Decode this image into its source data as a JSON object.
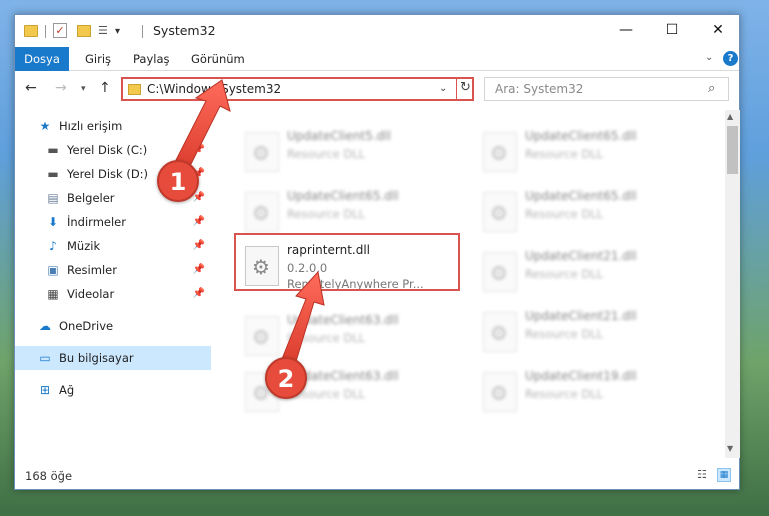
{
  "window": {
    "title": "System32",
    "min_glyph": "—",
    "max_glyph": "☐",
    "close_glyph": "✕"
  },
  "ribbon": {
    "file_tab": "Dosya",
    "tabs": [
      "Giriş",
      "Paylaş",
      "Görünüm"
    ],
    "help": "?"
  },
  "nav": {
    "back": "←",
    "forward": "→",
    "up": "↑",
    "address": "C:\\Windows\\System32",
    "refresh": "↻",
    "search_placeholder": "Ara: System32"
  },
  "sidebar": {
    "items": [
      {
        "label": "Hızlı erişim",
        "icon": "star-icon",
        "pinned": false
      },
      {
        "label": "Yerel Disk (C:)",
        "icon": "drive-icon",
        "pinned": true
      },
      {
        "label": "Yerel Disk (D:)",
        "icon": "drive-icon",
        "pinned": true
      },
      {
        "label": "Belgeler",
        "icon": "document-icon",
        "pinned": true
      },
      {
        "label": "İndirmeler",
        "icon": "download-icon",
        "pinned": true
      },
      {
        "label": "Müzik",
        "icon": "music-icon",
        "pinned": true
      },
      {
        "label": "Resimler",
        "icon": "picture-icon",
        "pinned": true
      },
      {
        "label": "Videolar",
        "icon": "video-icon",
        "pinned": true
      },
      {
        "label": "OneDrive",
        "icon": "cloud-icon",
        "pinned": false
      },
      {
        "label": "Bu bilgisayar",
        "icon": "computer-icon",
        "pinned": false,
        "selected": true
      },
      {
        "label": "Ağ",
        "icon": "network-icon",
        "pinned": false
      }
    ]
  },
  "files": {
    "highlighted": {
      "name": "raprinternt.dll",
      "version": "0.2.0.0",
      "company": "RemotelyAnywhere Pr..."
    },
    "left_column": [
      {
        "name": "UpdateClient5.dll",
        "type": "Resource DLL"
      },
      {
        "name": "UpdateClient65.dll",
        "type": "Resource DLL"
      },
      {
        "name": "UpdateClient63.dll",
        "type": "Resource DLL"
      },
      {
        "name": "UpdateClient63.dll",
        "type": "Resource DLL"
      }
    ],
    "right_column": [
      {
        "name": "UpdateClient65.dll",
        "type": "Resource DLL"
      },
      {
        "name": "UpdateClient65.dll",
        "type": "Resource DLL"
      },
      {
        "name": "UpdateClient21.dll",
        "type": "Resource DLL"
      },
      {
        "name": "UpdateClient21.dll",
        "type": "Resource DLL"
      },
      {
        "name": "UpdateClient19.dll",
        "type": "Resource DLL"
      }
    ]
  },
  "status": {
    "count": "168 öğe"
  },
  "annotations": {
    "step1": "1",
    "step2": "2",
    "color": "#e64b3c"
  }
}
